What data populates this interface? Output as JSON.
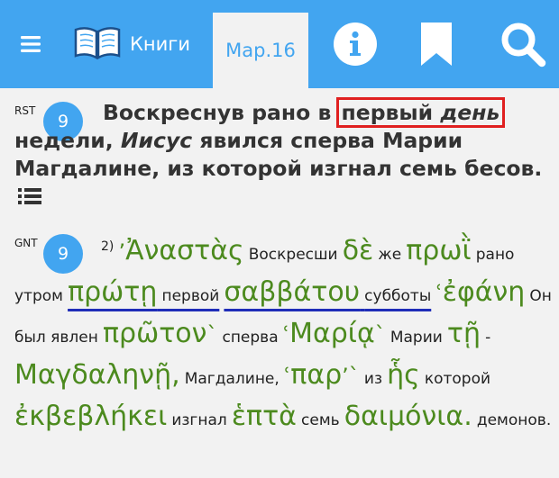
{
  "topbar": {
    "menu_icon": "menu-icon",
    "books_icon": "open-book-icon",
    "books_label": "Книги",
    "chapter_tab": "Мар.16",
    "info_icon": "info-icon",
    "bookmark_icon": "bookmark-icon",
    "search_icon": "search-icon",
    "bg_color": "#42a5f0"
  },
  "verse_rst": {
    "translation": "RST",
    "number": "9",
    "t1": "Воскреснув рано в",
    "highlight_word1": "первый",
    "highlight_word2": "день",
    "t2": "недели,",
    "name": "Иисус",
    "t3": "явился сперва Марии Магдалине, из которой изгнал семь бесов.",
    "list_icon": "list-icon",
    "highlight_color": "#e02020"
  },
  "verse_gnt": {
    "translation": "GNT",
    "number": "9",
    "footnote": "2)",
    "words": [
      {
        "mark_before": "’",
        "greek": "Ἀναστὰς",
        "russian": "Воскресши"
      },
      {
        "greek": "δὲ",
        "russian": "же"
      },
      {
        "greek": "πρωῒ",
        "russian": "рано утром"
      },
      {
        "greek": "πρώτῃ",
        "russian": "первой",
        "underlined": true
      },
      {
        "greek": "σαββάτου",
        "russian": "субботы",
        "underlined": true
      },
      {
        "mark_before": "ʿ",
        "greek": "ἐφάνη",
        "russian": "Он был явлен"
      },
      {
        "greek": "πρῶτον",
        "mark_after": "ˋ",
        "russian": "сперва"
      },
      {
        "mark_before": "ʿ",
        "greek": "Μαρίᾳ",
        "mark_after": "ˋ",
        "russian": "Марии"
      },
      {
        "greek": "τῇ",
        "russian": "-"
      },
      {
        "greek": "Μαγδαληνῇ,",
        "russian": "Магдалине,"
      },
      {
        "mark_before": "ʿ",
        "greek": "παρ",
        "mark_after": "’ˋ",
        "russian": "из"
      },
      {
        "greek": "ἧς",
        "russian": "которой"
      },
      {
        "greek": "ἐκβεβλήκει",
        "russian": "изгнал"
      },
      {
        "greek": "ἑπτὰ",
        "russian": "семь"
      },
      {
        "greek": "δαιμόνια.",
        "russian": "демонов."
      }
    ],
    "greek_color": "#4c8a1e",
    "underline_color": "#1f2db8"
  }
}
